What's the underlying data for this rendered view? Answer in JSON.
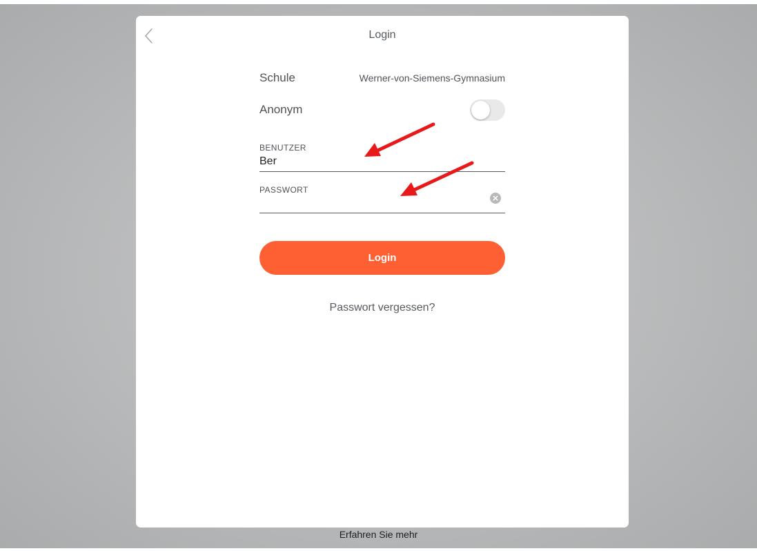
{
  "modal": {
    "title": "Login",
    "back_icon": "chevron-left-icon"
  },
  "form": {
    "school_label": "Schule",
    "school_value": "Werner-von-Siemens-Gymnasium",
    "anonymous_label": "Anonym",
    "anonymous_enabled": false,
    "user_label": "BENUTZER",
    "user_value": "Ber",
    "password_label": "PASSWORT",
    "password_value": "",
    "clear_icon": "clear-icon",
    "login_button": "Login",
    "forgot_link": "Passwort vergessen?"
  },
  "footer": {
    "learn_more": "Erfahren Sie mehr"
  },
  "colors": {
    "accent": "#fe6034",
    "annotation_arrow": "#e8191b",
    "background": "#bcbdbe"
  }
}
